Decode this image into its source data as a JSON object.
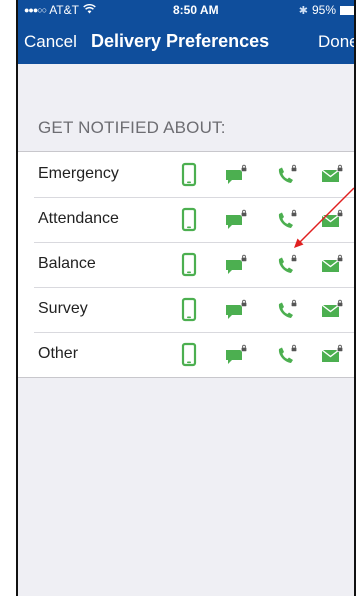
{
  "status_bar": {
    "signal": "●●●○○",
    "carrier": "AT&T",
    "time": "8:50 AM",
    "battery": "95%"
  },
  "nav": {
    "cancel_label": "Cancel",
    "title": "Delivery Preferences",
    "done_label": "Done"
  },
  "section_header": "GET NOTIFIED ABOUT:",
  "rows": [
    {
      "label": "Emergency"
    },
    {
      "label": "Attendance"
    },
    {
      "label": "Balance"
    },
    {
      "label": "Survey"
    },
    {
      "label": "Other"
    }
  ],
  "icons": {
    "push": "mobile-phone-icon",
    "text": "sms-bubble-lock-icon",
    "voice": "phone-call-lock-icon",
    "email": "envelope-lock-icon"
  },
  "colors": {
    "header_blue": "#0f4e9c",
    "icon_green": "#4caf50",
    "annotation_red": "#e02020"
  }
}
